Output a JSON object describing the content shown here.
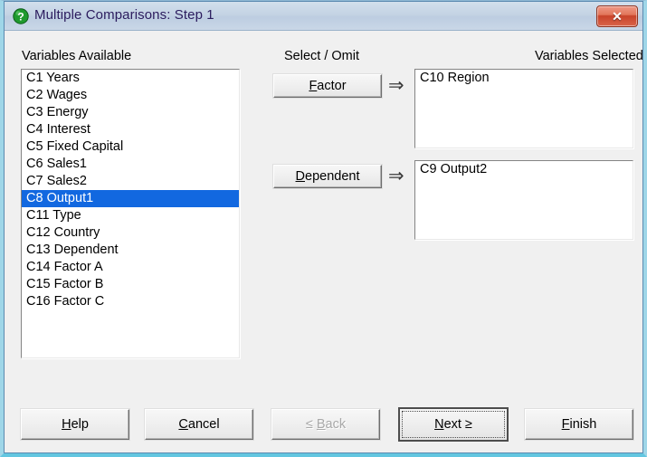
{
  "window": {
    "title": "Multiple Comparisons: Step 1",
    "title_icon": "green-question-help-icon",
    "close_label": "✕",
    "accent_titlebar": "#c4d3e4",
    "accent_close": "#c8432a",
    "accent_selection": "#1268e0"
  },
  "labels": {
    "variables_available": "Variables Available",
    "select_omit": "Select / Omit",
    "variables_selected": "Variables Selected"
  },
  "variables_available": [
    {
      "text": "C1 Years",
      "selected": false
    },
    {
      "text": "C2 Wages",
      "selected": false
    },
    {
      "text": "C3 Energy",
      "selected": false
    },
    {
      "text": "C4 Interest",
      "selected": false
    },
    {
      "text": "C5 Fixed Capital",
      "selected": false
    },
    {
      "text": "C6 Sales1",
      "selected": false
    },
    {
      "text": "C7 Sales2",
      "selected": false
    },
    {
      "text": "C8 Output1",
      "selected": true
    },
    {
      "text": "C11 Type",
      "selected": false
    },
    {
      "text": "C12 Country",
      "selected": false
    },
    {
      "text": "C13 Dependent",
      "selected": false
    },
    {
      "text": "C14 Factor A",
      "selected": false
    },
    {
      "text": "C15 Factor B",
      "selected": false
    },
    {
      "text": "C16 Factor C",
      "selected": false
    }
  ],
  "factor": {
    "button_prefix": "",
    "button_accel": "F",
    "button_rest": "actor",
    "arrow": "⇒",
    "items": [
      {
        "text": "C10 Region"
      }
    ]
  },
  "dependent": {
    "button_accel": "D",
    "button_rest": "ependent",
    "arrow": "⇒",
    "items": [
      {
        "text": "C9 Output2"
      }
    ]
  },
  "footer": {
    "help": {
      "accel": "H",
      "rest": "elp",
      "pre": "",
      "disabled": false,
      "default": false
    },
    "cancel": {
      "accel": "C",
      "rest": "ancel",
      "pre": "",
      "disabled": false,
      "default": false
    },
    "back": {
      "accel": "B",
      "rest": "ack",
      "pre": "≤ ",
      "disabled": true,
      "default": false
    },
    "next": {
      "accel": "N",
      "rest": "ext ≥",
      "pre": "",
      "disabled": false,
      "default": true
    },
    "finish": {
      "accel": "F",
      "rest": "inish",
      "pre": "",
      "disabled": false,
      "default": false
    }
  }
}
